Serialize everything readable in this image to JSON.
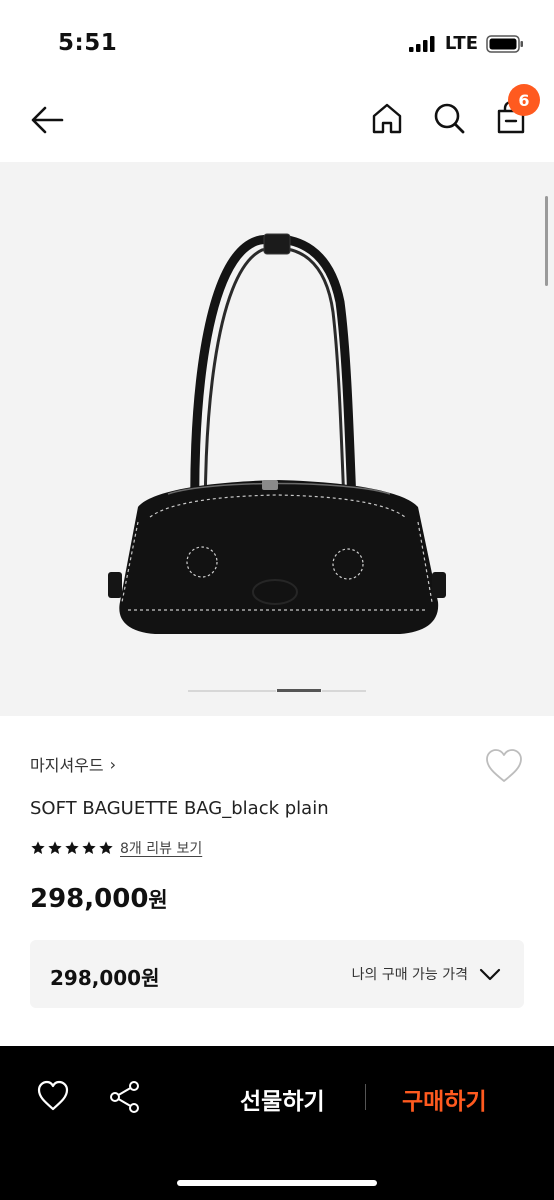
{
  "status_bar": {
    "time": "5:51",
    "network": "LTE"
  },
  "nav": {
    "cart_count": "6"
  },
  "product": {
    "brand": "마지셔우드",
    "brand_chevron": "›",
    "name": "SOFT BAGUETTE BAG_black plain",
    "rating_stars": 5,
    "review_link": "8개 리뷰 보기",
    "price": "298,000",
    "price_unit": "원",
    "image": {
      "subject": "handbag",
      "slide_count": 3,
      "active_slide": 2
    }
  },
  "my_price": {
    "value": "298,000원",
    "label": "나의 구매 가능 가격"
  },
  "bottom_bar": {
    "gift_label": "선물하기",
    "buy_label": "구매하기"
  },
  "colors": {
    "accent": "#ff5a1f",
    "bottom_bg": "#000000",
    "hero_bg": "#f3f3f3"
  },
  "icons": [
    "back-arrow-icon",
    "home-icon",
    "search-icon",
    "shopping-bag-icon",
    "heart-icon",
    "star-icon",
    "chevron-down-icon",
    "share-icon",
    "signal-icon",
    "battery-icon"
  ]
}
